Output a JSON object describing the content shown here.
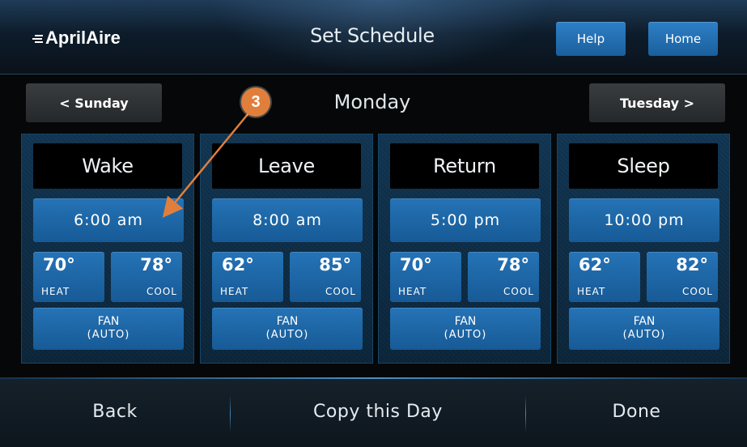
{
  "header": {
    "logo": "AprilAire",
    "title": "Set Schedule",
    "help_label": "Help",
    "home_label": "Home"
  },
  "day_nav": {
    "prev_label": "< Sunday",
    "current": "Monday",
    "next_label": "Tuesday >"
  },
  "periods": [
    {
      "name": "Wake",
      "time": "6:00 am",
      "heat": "70°",
      "cool": "78°",
      "heat_label": "HEAT",
      "cool_label": "COOL",
      "fan_label": "FAN",
      "fan_mode": "(AUTO)"
    },
    {
      "name": "Leave",
      "time": "8:00 am",
      "heat": "62°",
      "cool": "85°",
      "heat_label": "HEAT",
      "cool_label": "COOL",
      "fan_label": "FAN",
      "fan_mode": "(AUTO)"
    },
    {
      "name": "Return",
      "time": "5:00 pm",
      "heat": "70°",
      "cool": "78°",
      "heat_label": "HEAT",
      "cool_label": "COOL",
      "fan_label": "FAN",
      "fan_mode": "(AUTO)"
    },
    {
      "name": "Sleep",
      "time": "10:00 pm",
      "heat": "62°",
      "cool": "82°",
      "heat_label": "HEAT",
      "cool_label": "COOL",
      "fan_label": "FAN",
      "fan_mode": "(AUTO)"
    }
  ],
  "footer": {
    "back_label": "Back",
    "copy_label": "Copy this Day",
    "done_label": "Done"
  },
  "annotation": {
    "number": "3",
    "color": "#e07f3b"
  },
  "colors": {
    "button_blue": "#1f6aab",
    "panel_blue": "#0f3350",
    "accent_orange": "#e07f3b"
  }
}
